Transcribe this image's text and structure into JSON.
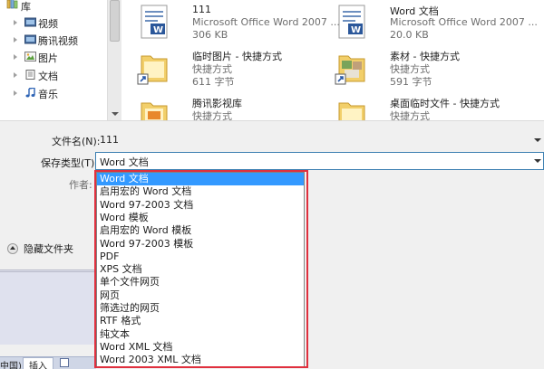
{
  "nav": {
    "library_label": "库",
    "items": [
      {
        "label": "视频",
        "icon": "video-folder-icon"
      },
      {
        "label": "腾讯视频",
        "icon": "tencent-video-folder-icon"
      },
      {
        "label": "图片",
        "icon": "pictures-folder-icon"
      },
      {
        "label": "文档",
        "icon": "documents-folder-icon"
      },
      {
        "label": "音乐",
        "icon": "music-note-icon"
      }
    ]
  },
  "files": [
    {
      "name": "111",
      "type": "Microsoft Office Word 2007 ...",
      "size": "306 KB",
      "icon": "word-doc-icon"
    },
    {
      "name": "Word 文档",
      "type": "Microsoft Office Word 2007 ...",
      "size": "20.0 KB",
      "icon": "word-doc-icon"
    },
    {
      "name": "临时图片 - 快捷方式",
      "type": "快捷方式",
      "size": "611 字节",
      "icon": "folder-shortcut-icon"
    },
    {
      "name": "素材 - 快捷方式",
      "type": "快捷方式",
      "size": "591 字节",
      "icon": "folder-shortcut-icon"
    },
    {
      "name": "腾讯影视库",
      "type": "快捷方式",
      "size": "",
      "icon": "folder-shortcut-icon"
    },
    {
      "name": "桌面临时文件 - 快捷方式",
      "type": "快捷方式",
      "size": "",
      "icon": "folder-shortcut-icon"
    }
  ],
  "form": {
    "filename_label": "文件名(N):",
    "filename_value": "111",
    "savetype_label": "保存类型(T):",
    "savetype_value": "Word 文档",
    "author_label": "作者:"
  },
  "dropdown_options": [
    "Word 文档",
    "启用宏的 Word 文档",
    "Word 97-2003 文档",
    "Word 模板",
    "启用宏的 Word 模板",
    "Word 97-2003 模板",
    "PDF",
    "XPS 文档",
    "单个文件网页",
    "网页",
    "筛选过的网页",
    "RTF 格式",
    "纯文本",
    "Word XML 文档",
    "Word 2003 XML 文档"
  ],
  "hide_folders_label": "隐藏文件夹",
  "ribbon": {
    "left": "中国)",
    "tab": "插入"
  },
  "colors": {
    "selection": "#3399ff",
    "highlight_box": "#e0303e",
    "lavender": "#dfe1ee"
  }
}
